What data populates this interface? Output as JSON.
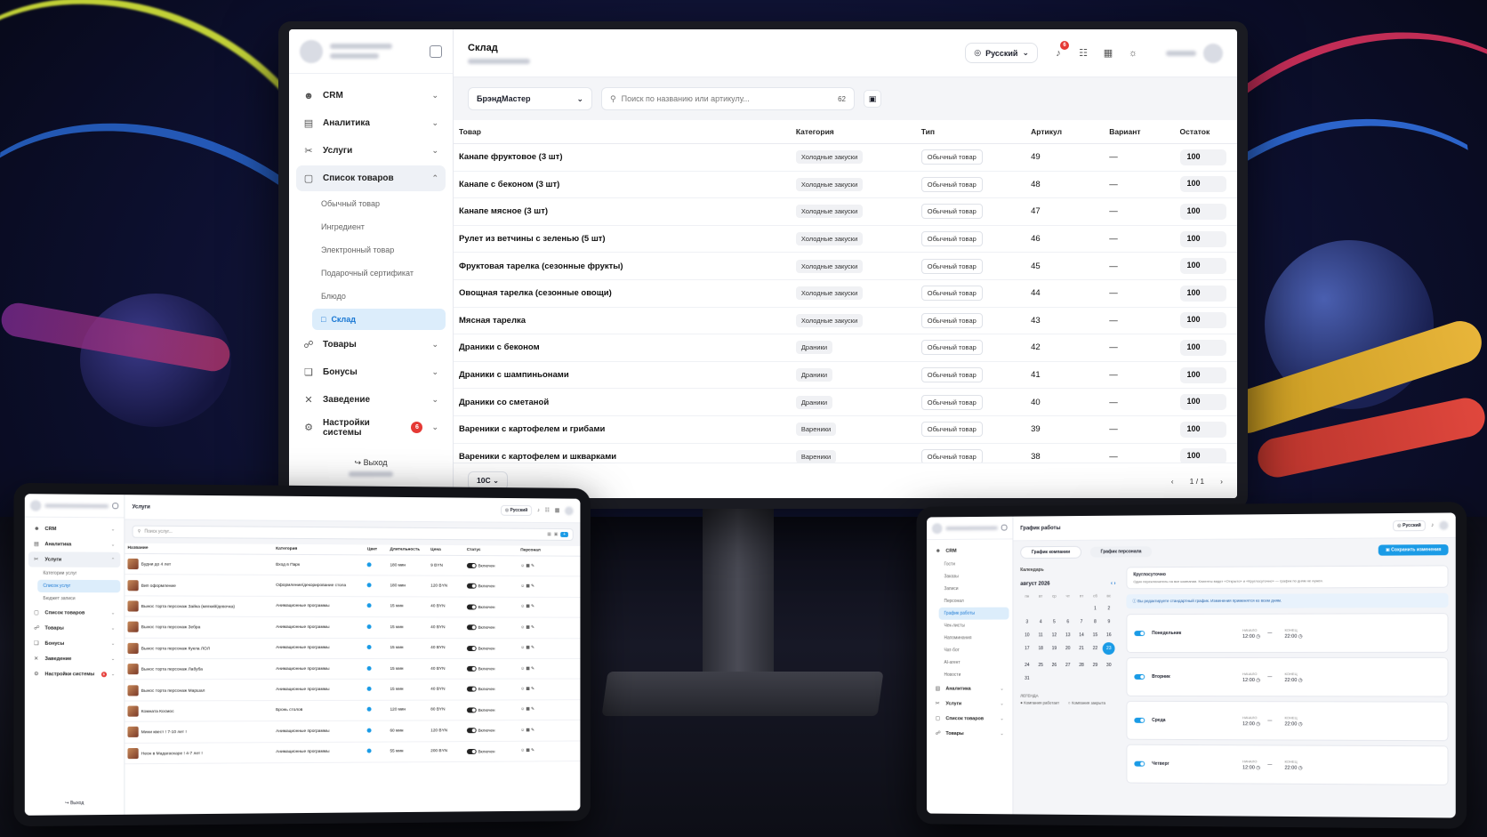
{
  "monitor": {
    "header": {
      "title": "Склад",
      "language": "Русский",
      "notifications_count": "6"
    },
    "sidebar": {
      "items": [
        {
          "label": "CRM",
          "icon": "users-icon"
        },
        {
          "label": "Аналитика",
          "icon": "chart-icon"
        },
        {
          "label": "Услуги",
          "icon": "scissors-icon"
        },
        {
          "label": "Список товаров",
          "icon": "clipboard-icon"
        }
      ],
      "sub_items": [
        "Обычный товар",
        "Ингредиент",
        "Электронный товар",
        "Подарочный сертификат",
        "Блюдо",
        "Склад"
      ],
      "items_after": [
        {
          "label": "Товары",
          "icon": "tag-icon"
        },
        {
          "label": "Бонусы",
          "icon": "gift-icon"
        },
        {
          "label": "Заведение",
          "icon": "utensils-icon"
        },
        {
          "label": "Настройки системы",
          "icon": "gear-icon",
          "badge": "6"
        }
      ],
      "logout": "Выход"
    },
    "toolbar": {
      "brand_select": "БрэндМастер",
      "search_placeholder": "Поиск по названию или артикулу...",
      "count": "62"
    },
    "table": {
      "columns": [
        "Товар",
        "Категория",
        "Тип",
        "Артикул",
        "Вариант",
        "Остаток"
      ],
      "rows": [
        {
          "name": "Канапе фруктовое (3 шт)",
          "category": "Холодные закуски",
          "type": "Обычный товар",
          "sku": "49",
          "variant": "—",
          "stock": "100"
        },
        {
          "name": "Канапе с беконом (3 шт)",
          "category": "Холодные закуски",
          "type": "Обычный товар",
          "sku": "48",
          "variant": "—",
          "stock": "100"
        },
        {
          "name": "Канапе мясное (3 шт)",
          "category": "Холодные закуски",
          "type": "Обычный товар",
          "sku": "47",
          "variant": "—",
          "stock": "100"
        },
        {
          "name": "Рулет из ветчины с зеленью (5 шт)",
          "category": "Холодные закуски",
          "type": "Обычный товар",
          "sku": "46",
          "variant": "—",
          "stock": "100"
        },
        {
          "name": "Фруктовая тарелка (сезонные фрукты)",
          "category": "Холодные закуски",
          "type": "Обычный товар",
          "sku": "45",
          "variant": "—",
          "stock": "100"
        },
        {
          "name": "Овощная тарелка (сезонные овощи)",
          "category": "Холодные закуски",
          "type": "Обычный товар",
          "sku": "44",
          "variant": "—",
          "stock": "100"
        },
        {
          "name": "Мясная тарелка",
          "category": "Холодные закуски",
          "type": "Обычный товар",
          "sku": "43",
          "variant": "—",
          "stock": "100"
        },
        {
          "name": "Драники с беконом",
          "category": "Драники",
          "type": "Обычный товар",
          "sku": "42",
          "variant": "—",
          "stock": "100"
        },
        {
          "name": "Драники с шампиньонами",
          "category": "Драники",
          "type": "Обычный товар",
          "sku": "41",
          "variant": "—",
          "stock": "100"
        },
        {
          "name": "Драники со сметаной",
          "category": "Драники",
          "type": "Обычный товар",
          "sku": "40",
          "variant": "—",
          "stock": "100"
        },
        {
          "name": "Вареники с картофелем и грибами",
          "category": "Вареники",
          "type": "Обычный товар",
          "sku": "39",
          "variant": "—",
          "stock": "100"
        },
        {
          "name": "Вареники с картофелем и шкварками",
          "category": "Вареники",
          "type": "Обычный товар",
          "sku": "38",
          "variant": "—",
          "stock": "100"
        }
      ]
    },
    "footer": {
      "page_size": "10C",
      "pagination": "1 / 1"
    }
  },
  "tablet_left": {
    "header": {
      "title": "Услуги",
      "language": "Русский"
    },
    "sidebar": {
      "items": [
        {
          "label": "CRM",
          "icon": "users-icon"
        },
        {
          "label": "Аналитика",
          "icon": "chart-icon"
        },
        {
          "label": "Услуги",
          "icon": "scissors-icon"
        }
      ],
      "sub_items": [
        "Категории услуг",
        "Список услуг",
        "Бюджет записи"
      ],
      "items_after": [
        {
          "label": "Список товаров",
          "icon": "clipboard-icon"
        },
        {
          "label": "Товары",
          "icon": "tag-icon"
        },
        {
          "label": "Бонусы",
          "icon": "gift-icon"
        },
        {
          "label": "Заведение",
          "icon": "utensils-icon"
        },
        {
          "label": "Настройки системы",
          "icon": "gear-icon",
          "badge": "6"
        }
      ],
      "logout": "Выход"
    },
    "search_placeholder": "Поиск услуг...",
    "columns": [
      "Название",
      "Категория",
      "Цвет",
      "Длительность",
      "Цена",
      "Статус",
      "Персонал"
    ],
    "rows": [
      {
        "name": "Будни до 4 лет",
        "category": "Вход в Парк",
        "duration": "180 мин",
        "price": "9 BYN",
        "status": "Включен"
      },
      {
        "name": "Вип оформление",
        "category": "Оформление/декорирование стола",
        "duration": "180 мин",
        "price": "120 BYN",
        "status": "Включен"
      },
      {
        "name": "Вынос торта персонаж Зайка (мягкий/девочка)",
        "category": "Анимационные программы",
        "duration": "15 мин",
        "price": "40 BYN",
        "status": "Включен"
      },
      {
        "name": "Вынос торта персонаж Зебра",
        "category": "Анимационные программы",
        "duration": "15 мин",
        "price": "40 BYN",
        "status": "Включен"
      },
      {
        "name": "Вынос торта персонаж Кукла ЛОЛ",
        "category": "Анимационные программы",
        "duration": "15 мин",
        "price": "40 BYN",
        "status": "Включен"
      },
      {
        "name": "Вынос торта персонаж Лабуба",
        "category": "Анимационные программы",
        "duration": "15 мин",
        "price": "40 BYN",
        "status": "Включен"
      },
      {
        "name": "Вынос торта персонаж Маршал",
        "category": "Анимационные программы",
        "duration": "15 мин",
        "price": "40 BYN",
        "status": "Включен"
      },
      {
        "name": "Комната Космос",
        "category": "Бронь столов",
        "duration": "120 мин",
        "price": "80 BYN",
        "status": "Включен"
      },
      {
        "name": "Мини квест ! 7-10 лет !",
        "category": "Анимационные программы",
        "duration": "60 мин",
        "price": "120 BYN",
        "status": "Включен"
      },
      {
        "name": "Неон в Мадагаскаре ! 4-7 лет !",
        "category": "Анимационные программы",
        "duration": "55 мин",
        "price": "200 BYN",
        "status": "Включен"
      }
    ]
  },
  "tablet_right": {
    "header": {
      "title": "График работы",
      "language": "Русский"
    },
    "sidebar": {
      "items": [
        {
          "label": "CRM",
          "icon": "users-icon"
        }
      ],
      "sub_items": [
        "Гости",
        "Заказы",
        "Записи",
        "Персонал",
        "График работы",
        "Чек-листы",
        "Напоминания",
        "Чат-бот",
        "AI-агент",
        "Новости"
      ],
      "items_after": [
        {
          "label": "Аналитика",
          "icon": "chart-icon"
        },
        {
          "label": "Услуги",
          "icon": "scissors-icon"
        },
        {
          "label": "Список товаров",
          "icon": "clipboard-icon"
        },
        {
          "label": "Товары",
          "icon": "tag-icon"
        }
      ]
    },
    "tabs": [
      "График компании",
      "График персонала"
    ],
    "save_label": "Сохранить изменения",
    "calendar": {
      "heading": "Календарь",
      "month": "август 2026",
      "weekdays": [
        "пн",
        "вт",
        "ср",
        "чт",
        "пт",
        "сб",
        "вс"
      ],
      "leading_blanks": 5,
      "days": [
        "1",
        "2",
        "3",
        "4",
        "5",
        "6",
        "7",
        "8",
        "9",
        "10",
        "11",
        "12",
        "13",
        "14",
        "15",
        "16",
        "17",
        "18",
        "19",
        "20",
        "21",
        "22",
        "23",
        "24",
        "25",
        "26",
        "27",
        "28",
        "29",
        "30",
        "31"
      ],
      "selected": "23",
      "legend_title": "ЛЕГЕНДА",
      "legend_items": [
        "Компания работает",
        "Компания закрыта"
      ]
    },
    "round_clock": {
      "title": "Круглосуточно",
      "description": "Один переключатель на все компании. Клиенты видят «Открыто» и «Круглосуточно» — график по дням не нужен."
    },
    "info": "Вы редактируете стандартный график. Изменения применятся ко всем дням.",
    "time_labels": {
      "start": "НАЧАЛО",
      "end": "КОНЕЦ"
    },
    "days": [
      {
        "name": "Понедельник",
        "start": "12:00",
        "end": "22:00"
      },
      {
        "name": "Вторник",
        "start": "12:00",
        "end": "22:00"
      },
      {
        "name": "Среда",
        "start": "12:00",
        "end": "22:00"
      },
      {
        "name": "Четверг",
        "start": "12:00",
        "end": "22:00"
      }
    ]
  }
}
